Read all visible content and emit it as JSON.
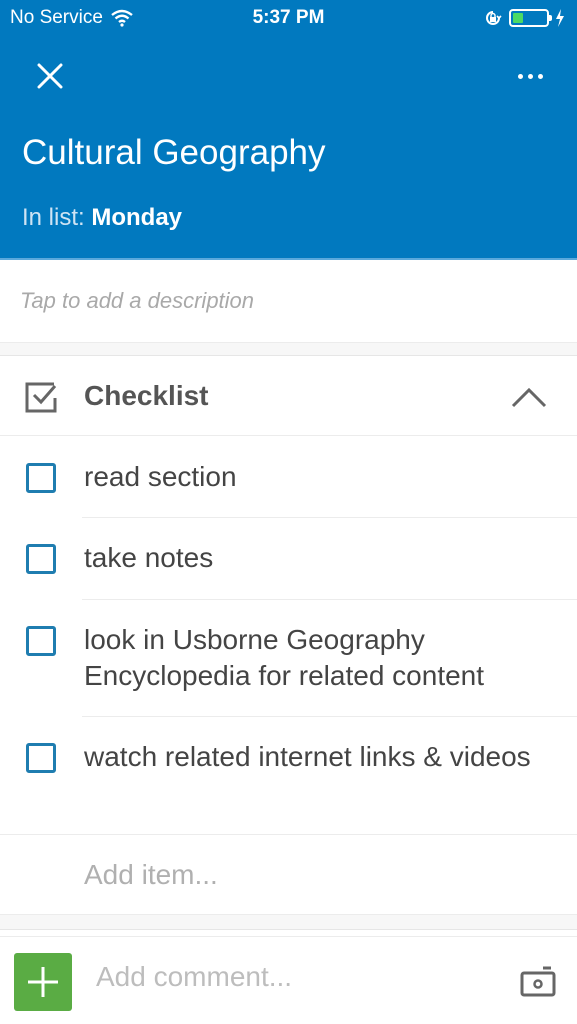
{
  "status_bar": {
    "carrier": "No Service",
    "time": "5:37 PM",
    "battery_level": 0.3,
    "icons": [
      "wifi-icon",
      "orientation-lock-icon",
      "battery-icon",
      "charging-icon"
    ]
  },
  "header": {
    "close_icon": "close-icon",
    "more_icon": "more-icon",
    "title": "Cultural Geography",
    "in_list_label": "In list:",
    "list_name": "Monday",
    "color": "#0179bf"
  },
  "description": {
    "placeholder": "Tap to add a description"
  },
  "checklist": {
    "title": "Checklist",
    "icon": "checklist-icon",
    "collapse_icon": "chevron-up-icon",
    "items": [
      {
        "label": "read section",
        "checked": false
      },
      {
        "label": "take notes",
        "checked": false
      },
      {
        "label": "look in Usborne Geography Encyclopedia for related content",
        "checked": false
      },
      {
        "label": "watch related internet links & videos",
        "checked": false
      }
    ],
    "add_item_placeholder": "Add item..."
  },
  "comment_bar": {
    "add_icon": "plus-icon",
    "placeholder": "Add comment...",
    "camera_icon": "camera-icon",
    "add_button_color": "#5aac44"
  }
}
